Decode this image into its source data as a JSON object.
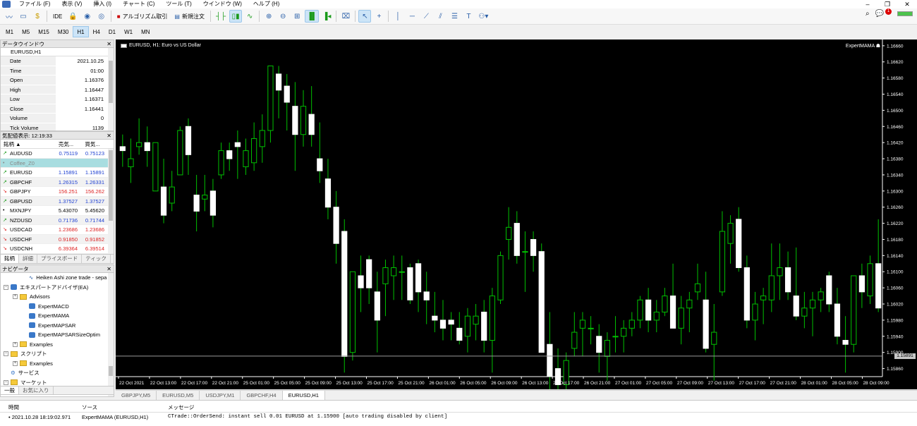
{
  "menu": {
    "items": [
      "ファイル (F)",
      "表示 (V)",
      "挿入 (I)",
      "チャート (C)",
      "ツール (T)",
      "ウインドウ (W)",
      "ヘルプ (H)"
    ]
  },
  "toolbar": {
    "ide": "IDE",
    "algo": "アルゴリズム取引",
    "neworder": "新規注文",
    "notif_count": "1"
  },
  "timeframes": [
    "M1",
    "M5",
    "M15",
    "M30",
    "H1",
    "H4",
    "D1",
    "W1",
    "MN"
  ],
  "active_timeframe": "H1",
  "datawin": {
    "title": "データウインドウ",
    "symbol": "EURUSD,H1",
    "rows": [
      {
        "k": "Date",
        "v": "2021.10.25"
      },
      {
        "k": "Time",
        "v": "01:00"
      },
      {
        "k": "Open",
        "v": "1.16376"
      },
      {
        "k": "High",
        "v": "1.16447"
      },
      {
        "k": "Low",
        "v": "1.16371"
      },
      {
        "k": "Close",
        "v": "1.16441"
      },
      {
        "k": "Volume",
        "v": "0"
      },
      {
        "k": "Tick Volume",
        "v": "1139"
      }
    ]
  },
  "quotes": {
    "title": "気配値表示: 12:19:33",
    "col_symbol": "銘柄",
    "col_bid": "売気...",
    "col_ask": "買気...",
    "rows": [
      {
        "s": "AUDUSD",
        "b": "0.75119",
        "a": "0.75123",
        "dir": "up",
        "arrow": "↗"
      },
      {
        "s": "Coffee_Z0",
        "b": "",
        "a": "",
        "dir": "none",
        "arrow": "•"
      },
      {
        "s": "EURUSD",
        "b": "1.15891",
        "a": "1.15891",
        "dir": "up",
        "arrow": "↗"
      },
      {
        "s": "GBPCHF",
        "b": "1.26315",
        "a": "1.26331",
        "dir": "up",
        "arrow": "↗"
      },
      {
        "s": "GBPJPY",
        "b": "156.251",
        "a": "156.262",
        "dir": "dn",
        "arrow": "↘"
      },
      {
        "s": "GBPUSD",
        "b": "1.37527",
        "a": "1.37527",
        "dir": "up",
        "arrow": "↗"
      },
      {
        "s": "MXNJPY",
        "b": "5.43070",
        "a": "5.45620",
        "dir": "none",
        "arrow": "•"
      },
      {
        "s": "NZDUSD",
        "b": "0.71736",
        "a": "0.71744",
        "dir": "up",
        "arrow": "↗"
      },
      {
        "s": "USDCAD",
        "b": "1.23686",
        "a": "1.23686",
        "dir": "dn",
        "arrow": "↘"
      },
      {
        "s": "USDCHF",
        "b": "0.91850",
        "a": "0.91852",
        "dir": "dn",
        "arrow": "↘"
      },
      {
        "s": "USDCNH",
        "b": "6.39364",
        "a": "6.39514",
        "dir": "dn",
        "arrow": "↘"
      }
    ],
    "tabs": [
      "銘柄",
      "詳細",
      "プライスボード",
      "ティック"
    ]
  },
  "nav": {
    "title": "ナビゲータ",
    "items": [
      {
        "t": "Heiken Ashi zone trade - sepa",
        "lvl": 3,
        "kind": "ind"
      },
      {
        "t": "エキスパートアドバイザ(EA)",
        "lvl": 1,
        "kind": "hat"
      },
      {
        "t": "Advisors",
        "lvl": 2,
        "kind": "fold"
      },
      {
        "t": "ExpertMACD",
        "lvl": 3,
        "kind": "hat"
      },
      {
        "t": "ExpertMAMA",
        "lvl": 3,
        "kind": "hat"
      },
      {
        "t": "ExpertMAPSAR",
        "lvl": 3,
        "kind": "hat"
      },
      {
        "t": "ExpertMAPSARSizeOptim",
        "lvl": 3,
        "kind": "hat"
      },
      {
        "t": "Examples",
        "lvl": 2,
        "kind": "fold"
      },
      {
        "t": "スクリプト",
        "lvl": 1,
        "kind": "fold"
      },
      {
        "t": "Examples",
        "lvl": 2,
        "kind": "fold"
      },
      {
        "t": "サービス",
        "lvl": 1,
        "kind": "gear"
      },
      {
        "t": "マーケット",
        "lvl": 1,
        "kind": "fold"
      }
    ],
    "tabs": [
      "一般",
      "お気に入り"
    ]
  },
  "chart": {
    "title": "EURUSD, H1:  Euro vs US Dollar",
    "ea": "ExpertMAMA",
    "current_price": "1.15891",
    "price_labels": [
      "1.16660",
      "1.16620",
      "1.16580",
      "1.16540",
      "1.16500",
      "1.16460",
      "1.16420",
      "1.16380",
      "1.16340",
      "1.16300",
      "1.16260",
      "1.16220",
      "1.16180",
      "1.16140",
      "1.16100",
      "1.16060",
      "1.16020",
      "1.15980",
      "1.15940",
      "1.15900",
      "1.15860"
    ],
    "time_labels": [
      "22 Oct 2021",
      "22 Oct 13:00",
      "22 Oct 17:00",
      "22 Oct 21:00",
      "25 Oct 01:00",
      "25 Oct 05:00",
      "25 Oct 09:00",
      "25 Oct 13:00",
      "25 Oct 17:00",
      "25 Oct 21:00",
      "26 Oct 01:00",
      "26 Oct 05:00",
      "26 Oct 09:00",
      "26 Oct 13:00",
      "26 Oct 17:00",
      "26 Oct 21:00",
      "27 Oct 01:00",
      "27 Oct 05:00",
      "27 Oct 09:00",
      "27 Oct 13:00",
      "27 Oct 17:00",
      "27 Oct 21:00",
      "28 Oct 01:00",
      "28 Oct 05:00",
      "28 Oct 09:00"
    ],
    "candles": [
      [
        1.1641,
        1.1644,
        1.1636,
        1.164
      ],
      [
        1.1636,
        1.1643,
        1.1632,
        1.1638
      ],
      [
        1.1641,
        1.1648,
        1.1639,
        1.1642
      ],
      [
        1.1642,
        1.1646,
        1.1636,
        1.164
      ],
      [
        1.163,
        1.1641,
        1.163,
        1.1642
      ],
      [
        1.1631,
        1.1638,
        1.1622,
        1.1624
      ],
      [
        1.1627,
        1.1635,
        1.1625,
        1.1631
      ],
      [
        1.1634,
        1.1646,
        1.1634,
        1.1645
      ],
      [
        1.1646,
        1.1648,
        1.1634,
        1.1639
      ],
      [
        1.1629,
        1.1634,
        1.162,
        1.1625
      ],
      [
        1.1628,
        1.1634,
        1.1625,
        1.1629
      ],
      [
        1.163,
        1.1633,
        1.1621,
        1.1624
      ],
      [
        1.1634,
        1.1642,
        1.1633,
        1.164
      ],
      [
        1.164,
        1.1642,
        1.1635,
        1.1638
      ],
      [
        1.1642,
        1.1645,
        1.1633,
        1.1641
      ],
      [
        1.1636,
        1.1643,
        1.1634,
        1.164
      ],
      [
        1.1637,
        1.1647,
        1.1635,
        1.1643
      ],
      [
        1.1641,
        1.1649,
        1.1637,
        1.1645
      ],
      [
        1.1645,
        1.1658,
        1.1642,
        1.1661
      ],
      [
        1.1659,
        1.1661,
        1.1648,
        1.1655
      ],
      [
        1.1656,
        1.1659,
        1.1645,
        1.1652
      ],
      [
        1.1651,
        1.1657,
        1.1635,
        1.1644
      ],
      [
        1.1644,
        1.1655,
        1.1641,
        1.1651
      ],
      [
        1.1649,
        1.1656,
        1.1641,
        1.1644
      ],
      [
        1.1638,
        1.1647,
        1.1632,
        1.1635
      ],
      [
        1.1633,
        1.1638,
        1.1623,
        1.1626
      ],
      [
        1.1626,
        1.163,
        1.1612,
        1.1617
      ],
      [
        1.162,
        1.1623,
        1.1585,
        1.1589
      ],
      [
        1.159,
        1.1604,
        1.1588,
        1.161
      ],
      [
        1.1609,
        1.1614,
        1.16,
        1.1606
      ],
      [
        1.1613,
        1.1614,
        1.1602,
        1.1606
      ],
      [
        1.1605,
        1.161,
        1.159,
        1.1598
      ],
      [
        1.1607,
        1.1613,
        1.1599,
        1.1611
      ],
      [
        1.1609,
        1.1614,
        1.1603,
        1.1611
      ],
      [
        1.161,
        1.1614,
        1.1603,
        1.161
      ],
      [
        1.1611,
        1.1612,
        1.1602,
        1.1603
      ],
      [
        1.1612,
        1.1613,
        1.16,
        1.1605
      ],
      [
        1.1605,
        1.161,
        1.1597,
        1.1603
      ],
      [
        1.1599,
        1.1605,
        1.1595,
        1.1598
      ],
      [
        1.1598,
        1.1603,
        1.1593,
        1.1596
      ],
      [
        1.1598,
        1.16,
        1.1593,
        1.1597
      ],
      [
        1.1596,
        1.16,
        1.1592,
        1.1593
      ],
      [
        1.1594,
        1.1601,
        1.159,
        1.1599
      ],
      [
        1.1597,
        1.1602,
        1.1593,
        1.1599
      ],
      [
        1.16,
        1.1603,
        1.159,
        1.1593
      ],
      [
        1.1593,
        1.1606,
        1.1585,
        1.1604
      ],
      [
        1.1603,
        1.1615,
        1.1602,
        1.1614
      ],
      [
        1.1618,
        1.1626,
        1.1613,
        1.1621
      ],
      [
        1.1622,
        1.1625,
        1.1612,
        1.1614
      ],
      [
        1.1615,
        1.162,
        1.1605,
        1.1615
      ],
      [
        1.1618,
        1.162,
        1.161,
        1.1614
      ],
      [
        1.1615,
        1.1617,
        1.1595,
        1.159
      ],
      [
        1.1592,
        1.16,
        1.158,
        1.1584
      ],
      [
        1.1586,
        1.1591,
        1.1578,
        1.1582
      ],
      [
        1.1582,
        1.159,
        1.1579,
        1.1588
      ],
      [
        1.1591,
        1.16,
        1.1589,
        1.1595
      ],
      [
        1.1596,
        1.16,
        1.1589,
        1.1598
      ],
      [
        1.1596,
        1.1599,
        1.1592,
        1.1596
      ],
      [
        1.1594,
        1.1597,
        1.1585,
        1.159
      ],
      [
        1.1589,
        1.1595,
        1.1583,
        1.1593
      ],
      [
        1.1594,
        1.1599,
        1.159,
        1.1594
      ],
      [
        1.1594,
        1.1598,
        1.159,
        1.1596
      ],
      [
        1.1596,
        1.16,
        1.1594,
        1.1598
      ],
      [
        1.1598,
        1.1604,
        1.1596,
        1.1603
      ],
      [
        1.1603,
        1.1606,
        1.1595,
        1.1598
      ],
      [
        1.1598,
        1.1603,
        1.1595,
        1.16
      ],
      [
        1.16,
        1.1606,
        1.1599,
        1.1604
      ],
      [
        1.1604,
        1.1612,
        1.1596,
        1.1596
      ],
      [
        1.1596,
        1.1604,
        1.1592,
        1.1601
      ],
      [
        1.1601,
        1.1605,
        1.1595,
        1.1603
      ],
      [
        1.1605,
        1.1612,
        1.1603,
        1.1607
      ],
      [
        1.1603,
        1.161,
        1.159,
        1.1591
      ],
      [
        1.1592,
        1.1602,
        1.1583,
        1.1595
      ],
      [
        1.1605,
        1.1625,
        1.1604,
        1.162
      ],
      [
        1.1617,
        1.1624,
        1.1612,
        1.1622
      ],
      [
        1.1623,
        1.1626,
        1.161,
        1.1611
      ],
      [
        1.1611,
        1.1614,
        1.1596,
        1.1598
      ],
      [
        1.1598,
        1.1605,
        1.1593,
        1.1602
      ],
      [
        1.1603,
        1.1606,
        1.1597,
        1.1604
      ],
      [
        1.1603,
        1.1617,
        1.16,
        1.1609
      ],
      [
        1.1609,
        1.1617,
        1.1603,
        1.1611
      ],
      [
        1.1611,
        1.1615,
        1.1603,
        1.1605
      ],
      [
        1.1604,
        1.1616,
        1.1598,
        1.1599
      ],
      [
        1.1599,
        1.1605,
        1.1596,
        1.1601
      ],
      [
        1.1601,
        1.1605,
        1.1594,
        1.1603
      ],
      [
        1.1603,
        1.1606,
        1.16,
        1.1605
      ],
      [
        1.1609,
        1.161,
        1.16,
        1.1602
      ],
      [
        1.1602,
        1.1606,
        1.1592,
        1.1594
      ],
      [
        1.1593,
        1.1599,
        1.1585,
        1.1592
      ],
      [
        1.1592,
        1.1609,
        1.159,
        1.1609
      ],
      [
        1.1609,
        1.1612,
        1.1601,
        1.1605
      ],
      [
        1.1604,
        1.1614,
        1.1602,
        1.1612
      ],
      [
        1.1612,
        1.1623,
        1.16,
        1.1601
      ]
    ],
    "ylim": [
      1.1584,
      1.16665
    ],
    "bg": "#000000",
    "fg": "#ffffff",
    "wick": "#00c000",
    "bull": "#000000",
    "bear": "#ffffff"
  },
  "chart_tabs": [
    "GBPJPY,M5",
    "EURUSD,M5",
    "USDJPY,M1",
    "GBPCHF,H4",
    "EURUSD,H1"
  ],
  "active_chart_tab": "EURUSD,H1",
  "toolbox": {
    "col_time": "時間",
    "col_source": "ソース",
    "col_msg": "メッセージ",
    "rows": [
      {
        "time": "2021.10.28 18:19:02.971",
        "source": "ExpertMAMA (EURUSD,H1)",
        "msg": "CTrade::OrderSend: instant sell 0.01 EURUSD at 1.15900 [auto trading disabled by client]"
      }
    ]
  }
}
